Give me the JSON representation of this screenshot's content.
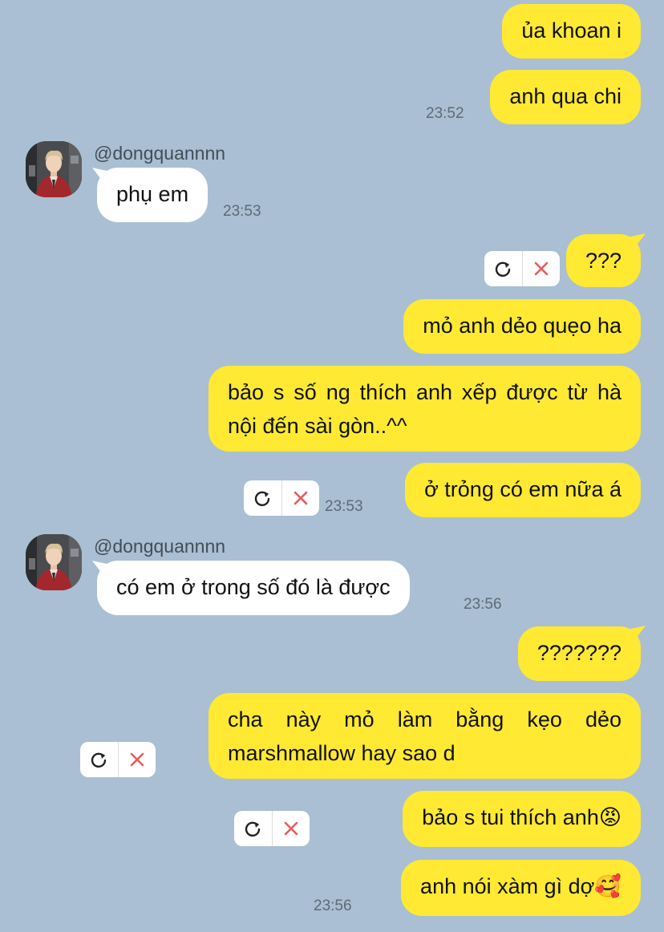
{
  "chat": {
    "messages": [
      {
        "text": "ủa khoan i"
      },
      {
        "text": "anh qua chi",
        "time": "23:52"
      },
      {
        "sender": "@dongquannnn",
        "text": "phụ em",
        "time": "23:53"
      },
      {
        "text": "???"
      },
      {
        "text": "mỏ anh dẻo quẹo ha"
      },
      {
        "text": "bảo s số ng thích anh xếp được từ hà nội đến sài gòn..^^"
      },
      {
        "text": "ở trỏng có em nữa á",
        "time": "23:53"
      },
      {
        "sender": "@dongquannnn",
        "text": "có em ở trong số đó là được",
        "time": "23:56"
      },
      {
        "text": "???????"
      },
      {
        "text": "cha này mỏ làm bằng kẹo dẻo marshmallow hay sao d"
      },
      {
        "text": "bảo s tui thích anh😡"
      },
      {
        "text": "anh nói xàm gì dợ🥰",
        "time": "23:56"
      }
    ]
  },
  "icons": {
    "retry": "retry-icon",
    "delete": "delete-icon",
    "avatar": "user-avatar"
  },
  "colors": {
    "background": "#aabfd3",
    "my_bubble": "#ffe933",
    "their_bubble": "#ffffff",
    "delete_icon": "#ea5a5a"
  }
}
